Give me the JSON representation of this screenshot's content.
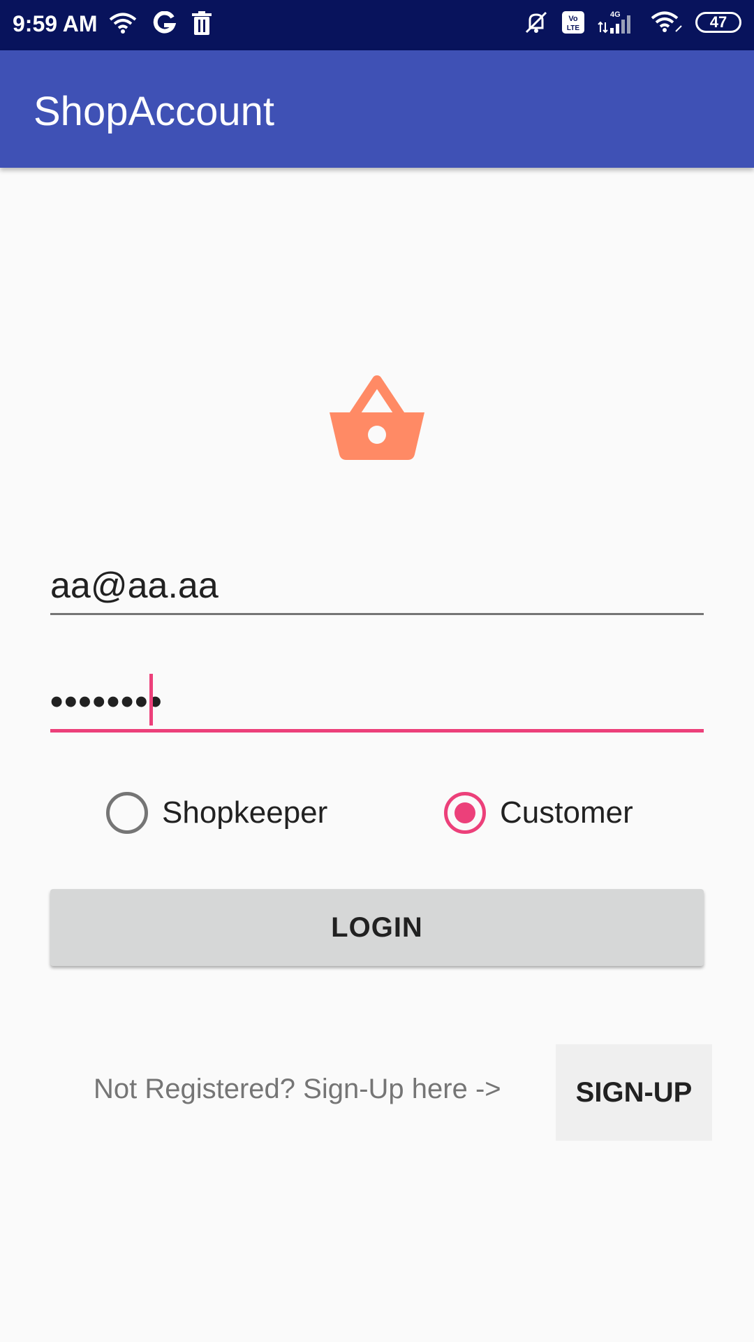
{
  "status_bar": {
    "time": "9:59 AM",
    "battery": "47",
    "icons_left": [
      "wifi-icon",
      "google-icon",
      "trash-icon"
    ],
    "icons_right": [
      "mute-icon",
      "volte-icon",
      "signal-4g-icon",
      "wifi-icon",
      "battery-icon"
    ]
  },
  "app_bar": {
    "title": "ShopAccount"
  },
  "logo": {
    "icon": "shopping-basket-icon",
    "color": "#ff8a65"
  },
  "form": {
    "email_value": "aa@aa.aa",
    "password_value": "••••••••",
    "radio_options": [
      {
        "label": "Shopkeeper",
        "checked": false
      },
      {
        "label": "Customer",
        "checked": true
      }
    ],
    "login_label": "LOGIN"
  },
  "footer": {
    "signup_prompt": "Not Registered? Sign-Up here ->",
    "signup_label": "SIGN-UP"
  },
  "colors": {
    "status_bar": "#08135c",
    "app_bar": "#3f51b5",
    "accent": "#ec407a",
    "logo": "#ff8a65"
  }
}
